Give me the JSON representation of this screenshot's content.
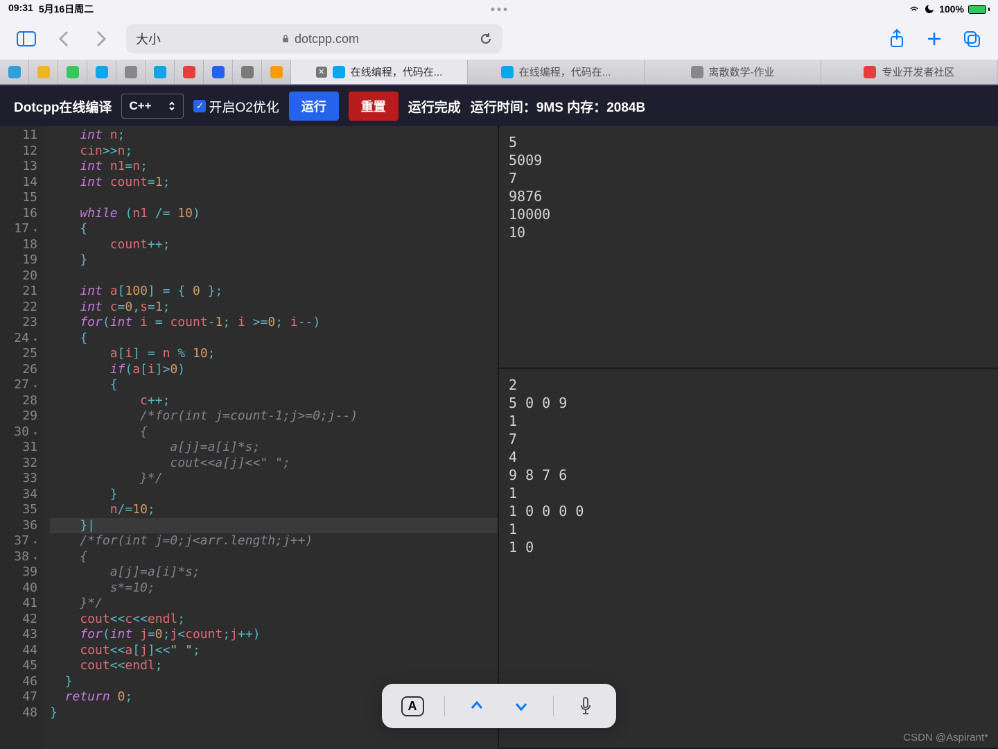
{
  "status_bar": {
    "time": "09:31",
    "date": "5月16日周二",
    "battery_pct": "100%"
  },
  "safari": {
    "zoom_label": "大小",
    "url_host": "dotcpp.com"
  },
  "mini_tabs_colors": [
    "#2f9fdd",
    "#f0b429",
    "#34c759",
    "#0ea5e9",
    "#888",
    "#0ea5e9",
    "#e53e3e",
    "#2563eb",
    "#7a7a7a",
    "#f59e0b"
  ],
  "big_tabs": [
    {
      "label": "在线编程，代码在...",
      "icon": "#0ea5e9",
      "active": true,
      "closable": true
    },
    {
      "label": "在线编程，代码在...",
      "icon": "#0ea5e9"
    },
    {
      "label": "离散数学-作业",
      "icon": "#888"
    },
    {
      "label": "专业开发者社区",
      "icon": "#e53e3e"
    }
  ],
  "dotcpp": {
    "title": "Dotcpp在线编译",
    "lang": "C++",
    "o2_label": "开启O2优化",
    "run": "运行",
    "reset": "重置",
    "status_done": "运行完成",
    "status_time_label": "运行时间：",
    "status_time": "9MS",
    "status_mem_label": "内存：",
    "status_mem": "2084B"
  },
  "gutter": [
    {
      "n": "11"
    },
    {
      "n": "12"
    },
    {
      "n": "13"
    },
    {
      "n": "14"
    },
    {
      "n": "15"
    },
    {
      "n": "16"
    },
    {
      "n": "17",
      "f": true
    },
    {
      "n": "18"
    },
    {
      "n": "19"
    },
    {
      "n": "20"
    },
    {
      "n": "21"
    },
    {
      "n": "22"
    },
    {
      "n": "23"
    },
    {
      "n": "24",
      "f": true
    },
    {
      "n": "25"
    },
    {
      "n": "26"
    },
    {
      "n": "27",
      "f": true
    },
    {
      "n": "28"
    },
    {
      "n": "29"
    },
    {
      "n": "30",
      "f": true
    },
    {
      "n": "31"
    },
    {
      "n": "32"
    },
    {
      "n": "33"
    },
    {
      "n": "34"
    },
    {
      "n": "35"
    },
    {
      "n": "36"
    },
    {
      "n": "37",
      "f": true
    },
    {
      "n": "38",
      "f": true
    },
    {
      "n": "39"
    },
    {
      "n": "40"
    },
    {
      "n": "41"
    },
    {
      "n": "42"
    },
    {
      "n": "43"
    },
    {
      "n": "44"
    },
    {
      "n": "45"
    },
    {
      "n": "46"
    },
    {
      "n": "47"
    },
    {
      "n": "48"
    }
  ],
  "code_lines": [
    {
      "t": [
        [
          "ty",
          "    int "
        ],
        [
          "id",
          "n"
        ],
        [
          "op",
          ";"
        ]
      ]
    },
    {
      "t": [
        [
          "id",
          "    cin"
        ],
        [
          "op",
          ">>"
        ],
        [
          "id",
          "n"
        ],
        [
          "op",
          ";"
        ]
      ]
    },
    {
      "t": [
        [
          "ty",
          "    int "
        ],
        [
          "id",
          "n1"
        ],
        [
          "op",
          "="
        ],
        [
          "id",
          "n"
        ],
        [
          "op",
          ";"
        ]
      ]
    },
    {
      "t": [
        [
          "ty",
          "    int "
        ],
        [
          "id",
          "count"
        ],
        [
          "op",
          "="
        ],
        [
          "num",
          "1"
        ],
        [
          "op",
          ";"
        ]
      ]
    },
    {
      "t": [
        [
          "",
          ""
        ]
      ]
    },
    {
      "t": [
        [
          "kw",
          "    while "
        ],
        [
          "op",
          "("
        ],
        [
          "id",
          "n1 "
        ],
        [
          "op",
          "/= "
        ],
        [
          "num",
          "10"
        ],
        [
          "op",
          ")"
        ]
      ]
    },
    {
      "t": [
        [
          "op",
          "    {"
        ]
      ]
    },
    {
      "t": [
        [
          "id",
          "        count"
        ],
        [
          "op",
          "++"
        ],
        [
          "op",
          ";"
        ]
      ]
    },
    {
      "t": [
        [
          "op",
          "    }"
        ]
      ]
    },
    {
      "t": [
        [
          "",
          ""
        ]
      ]
    },
    {
      "t": [
        [
          "ty",
          "    int "
        ],
        [
          "id",
          "a"
        ],
        [
          "op",
          "["
        ],
        [
          "num",
          "100"
        ],
        [
          "op",
          "] = { "
        ],
        [
          "num",
          "0"
        ],
        [
          "op",
          " };"
        ]
      ]
    },
    {
      "t": [
        [
          "ty",
          "    int "
        ],
        [
          "id",
          "c"
        ],
        [
          "op",
          "="
        ],
        [
          "num",
          "0"
        ],
        [
          "op",
          ","
        ],
        [
          "id",
          "s"
        ],
        [
          "op",
          "="
        ],
        [
          "num",
          "1"
        ],
        [
          "op",
          ";"
        ]
      ]
    },
    {
      "t": [
        [
          "kw",
          "    for"
        ],
        [
          "op",
          "("
        ],
        [
          "ty",
          "int "
        ],
        [
          "id",
          "i "
        ],
        [
          "op",
          "= "
        ],
        [
          "id",
          "count"
        ],
        [
          "op",
          "-"
        ],
        [
          "num",
          "1"
        ],
        [
          "op",
          "; "
        ],
        [
          "id",
          "i "
        ],
        [
          "op",
          ">="
        ],
        [
          "num",
          "0"
        ],
        [
          "op",
          "; "
        ],
        [
          "id",
          "i"
        ],
        [
          "op",
          "--"
        ],
        [
          "op",
          ")"
        ]
      ]
    },
    {
      "t": [
        [
          "op",
          "    {"
        ]
      ]
    },
    {
      "t": [
        [
          "id",
          "        a"
        ],
        [
          "op",
          "["
        ],
        [
          "id",
          "i"
        ],
        [
          "op",
          "] "
        ],
        [
          "op",
          "= "
        ],
        [
          "id",
          "n "
        ],
        [
          "op",
          "% "
        ],
        [
          "num",
          "10"
        ],
        [
          "op",
          ";"
        ]
      ]
    },
    {
      "t": [
        [
          "kw",
          "        if"
        ],
        [
          "op",
          "("
        ],
        [
          "id",
          "a"
        ],
        [
          "op",
          "["
        ],
        [
          "id",
          "i"
        ],
        [
          "op",
          "]"
        ],
        [
          "op",
          ">"
        ],
        [
          "num",
          "0"
        ],
        [
          "op",
          ")"
        ]
      ]
    },
    {
      "t": [
        [
          "op",
          "        {"
        ]
      ]
    },
    {
      "t": [
        [
          "id",
          "            c"
        ],
        [
          "op",
          "++"
        ],
        [
          "op",
          ";"
        ]
      ]
    },
    {
      "t": [
        [
          "cm",
          "            /*for(int j=count-1;j>=0;j--)"
        ]
      ]
    },
    {
      "t": [
        [
          "cm",
          "            {"
        ]
      ]
    },
    {
      "t": [
        [
          "cm",
          "                a[j]=a[i]*s;"
        ]
      ]
    },
    {
      "t": [
        [
          "cm",
          "                cout<<a[j]<<\" \";"
        ]
      ]
    },
    {
      "t": [
        [
          "cm",
          "            }*/"
        ]
      ]
    },
    {
      "t": [
        [
          "op",
          "        }"
        ]
      ]
    },
    {
      "t": [
        [
          "id",
          "        n"
        ],
        [
          "op",
          "/="
        ],
        [
          "num",
          "10"
        ],
        [
          "op",
          ";"
        ]
      ]
    },
    {
      "hl": true,
      "t": [
        [
          "op",
          "    }|"
        ]
      ]
    },
    {
      "t": [
        [
          "cm",
          "    /*for(int j=0;j<arr.length;j++)"
        ]
      ]
    },
    {
      "t": [
        [
          "cm",
          "    {"
        ]
      ]
    },
    {
      "t": [
        [
          "cm",
          "        a[j]=a[i]*s;"
        ]
      ]
    },
    {
      "t": [
        [
          "cm",
          "        s*=10;"
        ]
      ]
    },
    {
      "t": [
        [
          "cm",
          "    }*/"
        ]
      ]
    },
    {
      "t": [
        [
          "id",
          "    cout"
        ],
        [
          "op",
          "<<"
        ],
        [
          "id",
          "c"
        ],
        [
          "op",
          "<<"
        ],
        [
          "id",
          "endl"
        ],
        [
          "op",
          ";"
        ]
      ]
    },
    {
      "t": [
        [
          "kw",
          "    for"
        ],
        [
          "op",
          "("
        ],
        [
          "ty",
          "int "
        ],
        [
          "id",
          "j"
        ],
        [
          "op",
          "="
        ],
        [
          "num",
          "0"
        ],
        [
          "op",
          ";"
        ],
        [
          "id",
          "j"
        ],
        [
          "op",
          "<"
        ],
        [
          "id",
          "count"
        ],
        [
          "op",
          ";"
        ],
        [
          "id",
          "j"
        ],
        [
          "op",
          "++"
        ],
        [
          "op",
          ")"
        ]
      ]
    },
    {
      "t": [
        [
          "id",
          "    cout"
        ],
        [
          "op",
          "<<"
        ],
        [
          "id",
          "a"
        ],
        [
          "op",
          "["
        ],
        [
          "id",
          "j"
        ],
        [
          "op",
          "]"
        ],
        [
          "op",
          "<<"
        ],
        [
          "st",
          "\" \""
        ],
        [
          "op",
          ";"
        ]
      ]
    },
    {
      "t": [
        [
          "id",
          "    cout"
        ],
        [
          "op",
          "<<"
        ],
        [
          "id",
          "endl"
        ],
        [
          "op",
          ";"
        ]
      ]
    },
    {
      "t": [
        [
          "op",
          "  }"
        ]
      ]
    },
    {
      "t": [
        [
          "ret",
          "  return "
        ],
        [
          "num",
          "0"
        ],
        [
          "op",
          ";"
        ]
      ]
    },
    {
      "t": [
        [
          "op",
          "}"
        ]
      ]
    }
  ],
  "input_panel": "5\n5009\n7\n9876\n10000\n10",
  "output_panel": "2\n5 0 0 9\n1\n7\n4\n9 8 7 6\n1\n1 0 0 0 0\n1\n1 0",
  "watermark": "CSDN @Aspirant*"
}
